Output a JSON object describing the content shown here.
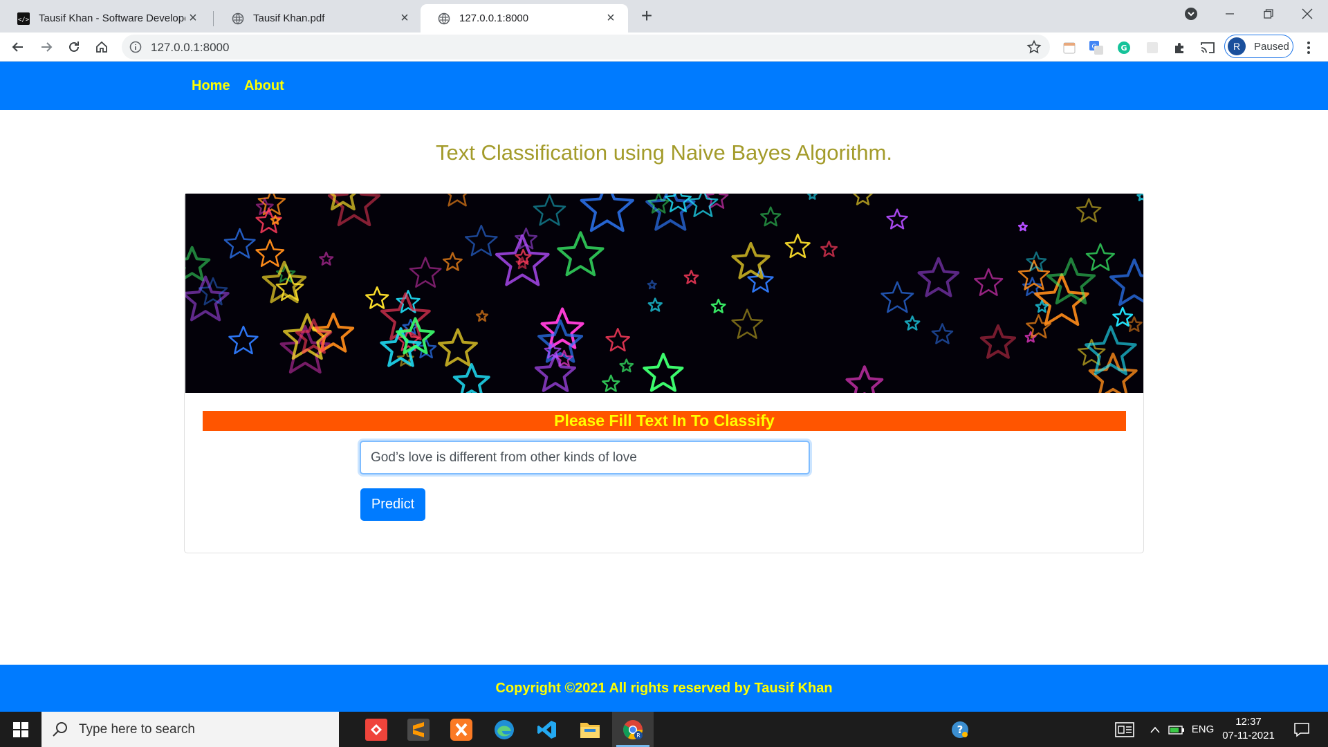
{
  "browser": {
    "tabs": [
      {
        "title": "Tausif Khan - Software Developer",
        "active": false
      },
      {
        "title": "Tausif Khan.pdf",
        "active": false
      },
      {
        "title": "127.0.0.1:8000",
        "active": true
      }
    ],
    "url": "127.0.0.1:8000",
    "profile_initial": "R",
    "profile_status": "Paused"
  },
  "page": {
    "nav": {
      "home": "Home",
      "about": "About"
    },
    "title": "Text Classification using Naive Bayes Algorithm.",
    "banner_icon": "neon-stars-image",
    "form": {
      "heading": "Please Fill Text In To Classify",
      "input_value": "God’s love is different from other kinds of love",
      "button_label": "Predict"
    },
    "footer": "Copyright ©2021 All rights reserved by Tausif Khan",
    "colors": {
      "navbar": "#007bff",
      "nav_text": "#ffff00",
      "title": "#a39b2a",
      "heading_bar": "#ff5500",
      "button": "#007bff",
      "footer": "#007bff"
    }
  },
  "taskbar": {
    "search_placeholder": "Type here to search",
    "language": "ENG",
    "time": "12:37",
    "date": "07-11-2021"
  }
}
